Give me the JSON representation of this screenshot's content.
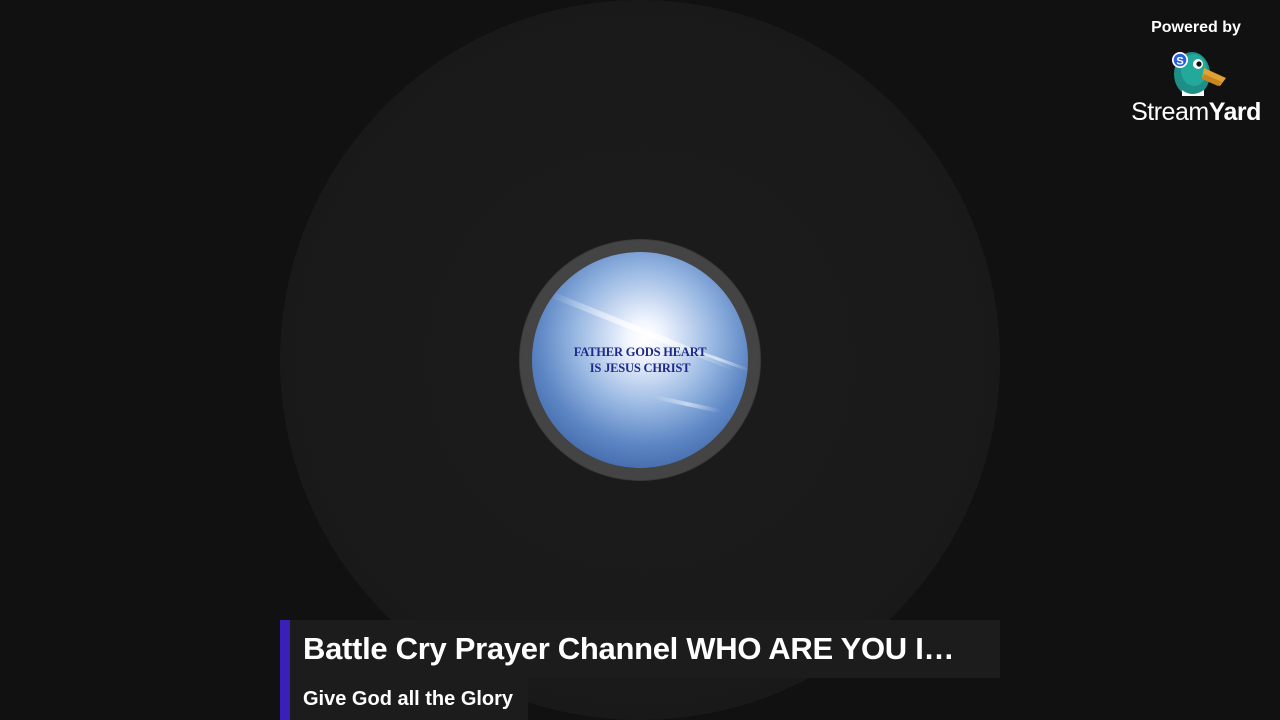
{
  "powered_by": {
    "label": "Powered by",
    "brand_light": "Stream",
    "brand_bold": "Yard",
    "logo_icon": "streamyard-duck-icon"
  },
  "avatar": {
    "line1": "FATHER GODS HEART",
    "line2": "IS JESUS CHRIST"
  },
  "banner": {
    "title": "Battle Cry Prayer Channel WHO ARE YOU IN CHRIST",
    "subtitle": "Give God all the Glory"
  },
  "colors": {
    "background": "#111111",
    "accent": "#3a1fb8",
    "banner_bg": "#1c1c1c",
    "text": "#ffffff"
  }
}
